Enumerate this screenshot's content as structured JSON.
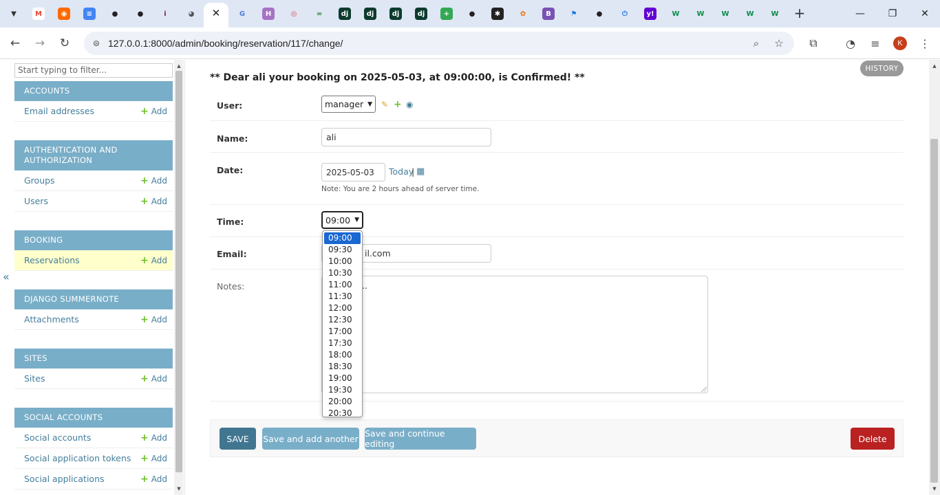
{
  "browser": {
    "tabs": [
      {
        "icon": "gmail-icon",
        "glyph": "M",
        "color": "#ffffff",
        "fg": "#ea4335"
      },
      {
        "icon": "ring-icon",
        "glyph": "◉",
        "color": "#ff6a00",
        "fg": "#ffffff"
      },
      {
        "icon": "docs-icon",
        "glyph": "≡",
        "color": "#4285f4",
        "fg": "#ffffff"
      },
      {
        "icon": "github-icon",
        "glyph": "●",
        "color": "#dfe7f5",
        "fg": "#222222"
      },
      {
        "icon": "github-icon",
        "glyph": "●",
        "color": "#dfe7f5",
        "fg": "#222222"
      },
      {
        "icon": "person-icon",
        "glyph": "i",
        "color": "#dfe7f5",
        "fg": "#7a2a3a"
      },
      {
        "icon": "globe-icon",
        "glyph": "◕",
        "color": "#dfe7f5",
        "fg": "#555555"
      },
      {
        "icon": "translate-icon",
        "glyph": "G",
        "color": "#dfe7f5",
        "fg": "#4a7bd8"
      },
      {
        "icon": "h-icon",
        "glyph": "H",
        "color": "#a772c4",
        "fg": "#ffffff"
      },
      {
        "icon": "target-icon",
        "glyph": "◎",
        "color": "#dfe7f5",
        "fg": "#e04a4a"
      },
      {
        "icon": "link-icon",
        "glyph": "∞",
        "color": "#dfe7f5",
        "fg": "#2e7d32"
      },
      {
        "icon": "django-icon",
        "glyph": "dj",
        "color": "#0c3b2e",
        "fg": "#ffffff"
      },
      {
        "icon": "django-icon",
        "glyph": "dj",
        "color": "#0c3b2e",
        "fg": "#ffffff"
      },
      {
        "icon": "django-icon",
        "glyph": "dj",
        "color": "#0c3b2e",
        "fg": "#ffffff"
      },
      {
        "icon": "django-icon",
        "glyph": "dj",
        "color": "#0c3b2e",
        "fg": "#ffffff"
      },
      {
        "icon": "sheets-plus-icon",
        "glyph": "+",
        "color": "#34a853",
        "fg": "#ffffff"
      },
      {
        "icon": "github-icon",
        "glyph": "●",
        "color": "#dfe7f5",
        "fg": "#222222"
      },
      {
        "icon": "asterisk-icon",
        "glyph": "✱",
        "color": "#222222",
        "fg": "#ffffff"
      },
      {
        "icon": "puzzle-icon",
        "glyph": "✿",
        "color": "#dfe7f5",
        "fg": "#e8710a"
      },
      {
        "icon": "bootstrap-icon",
        "glyph": "B",
        "color": "#7952b3",
        "fg": "#ffffff"
      },
      {
        "icon": "flag-icon",
        "glyph": "⚑",
        "color": "#dfe7f5",
        "fg": "#1a73e8"
      },
      {
        "icon": "github-icon",
        "glyph": "●",
        "color": "#dfe7f5",
        "fg": "#222222"
      },
      {
        "icon": "power-icon",
        "glyph": "⏻",
        "color": "#dfe7f5",
        "fg": "#1a73e8"
      },
      {
        "icon": "yahoo-icon",
        "glyph": "y!",
        "color": "#6001d2",
        "fg": "#ffffff"
      },
      {
        "icon": "w-icon",
        "glyph": "W",
        "color": "#dfe7f5",
        "fg": "#0b8a4a"
      },
      {
        "icon": "w-icon",
        "glyph": "W",
        "color": "#dfe7f5",
        "fg": "#0b8a4a"
      },
      {
        "icon": "w-icon",
        "glyph": "W",
        "color": "#dfe7f5",
        "fg": "#0b8a4a"
      },
      {
        "icon": "w-icon",
        "glyph": "W",
        "color": "#dfe7f5",
        "fg": "#0b8a4a"
      },
      {
        "icon": "w-icon",
        "glyph": "W",
        "color": "#dfe7f5",
        "fg": "#0b8a4a"
      }
    ],
    "url": "127.0.0.1:8000/admin/booking/reservation/117/change/",
    "avatar_letter": "K"
  },
  "sidebar": {
    "filter_placeholder": "Start typing to filter...",
    "collapse_glyph": "«",
    "add_label": "Add",
    "modules": [
      {
        "title": "ACCOUNTS",
        "models": [
          "Email addresses"
        ]
      },
      {
        "title": "AUTHENTICATION AND AUTHORIZATION",
        "models": [
          "Groups",
          "Users"
        ]
      },
      {
        "title": "BOOKING",
        "models": [
          "Reservations"
        ]
      },
      {
        "title": "DJANGO SUMMERNOTE",
        "models": [
          "Attachments"
        ]
      },
      {
        "title": "SITES",
        "models": [
          "Sites"
        ]
      },
      {
        "title": "SOCIAL ACCOUNTS",
        "models": [
          "Social accounts",
          "Social application tokens",
          "Social applications"
        ]
      }
    ]
  },
  "main": {
    "history_label": "HISTORY",
    "confirmation": "** Dear ali your booking on 2025-05-03, at 09:00:00, is Confirmed! **",
    "fields": {
      "user_label": "User:",
      "user_value": "manager",
      "name_label": "Name:",
      "name_value": "ali",
      "date_label": "Date:",
      "date_value": "2025-05-03",
      "today_label": "Today",
      "date_sep": "|",
      "date_note": "Note: You are 2 hours ahead of server time.",
      "time_label": "Time:",
      "time_value": "09:00",
      "email_label": "Email:",
      "email_value_visible": "il.com",
      "notes_label": "Notes:",
      "notes_value_visible": ".."
    },
    "time_options": [
      "09:00",
      "09:30",
      "10:00",
      "10:30",
      "11:00",
      "11:30",
      "12:00",
      "12:30",
      "17:00",
      "17:30",
      "18:00",
      "18:30",
      "19:00",
      "19:30",
      "20:00",
      "20:30"
    ],
    "buttons": {
      "save": "SAVE",
      "save_add": "Save and add another",
      "save_continue": "Save and continue editing",
      "delete": "Delete"
    },
    "colors": {
      "module_header": "#79aec8",
      "link": "#447e9b",
      "save_button": "#417690",
      "secondary_button": "#79aec8",
      "delete_button": "#ba2121",
      "selected_option": "#1967d2"
    }
  }
}
